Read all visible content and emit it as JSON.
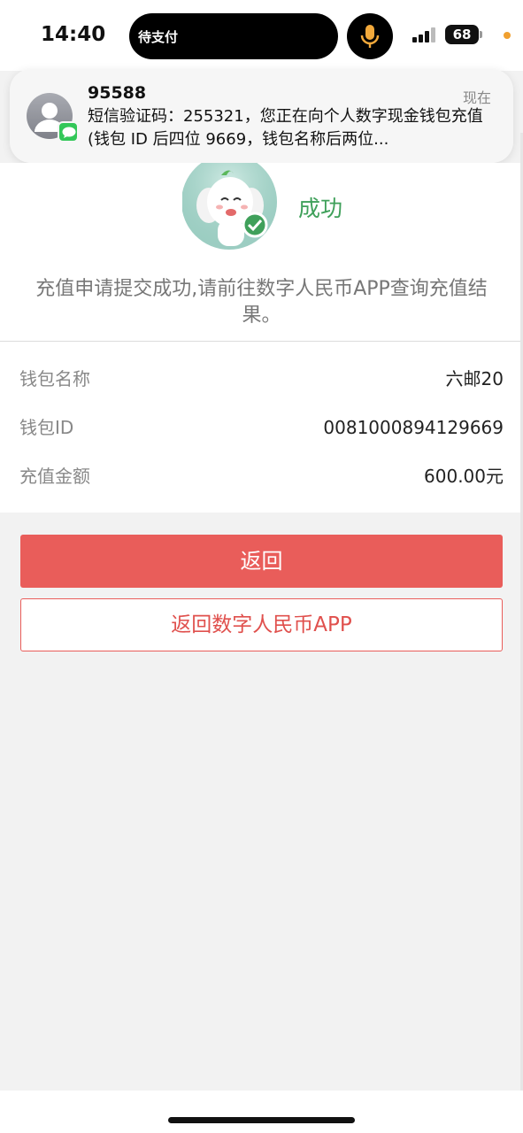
{
  "status_bar": {
    "time": "14:40",
    "island_label": "待支付",
    "battery": "68",
    "mic_color": "#f2a93b",
    "icons": [
      "mic-icon",
      "signal-icon",
      "battery-icon"
    ]
  },
  "notification": {
    "sender": "95588",
    "time": "现在",
    "body": "短信验证码：255321，您正在向个人数字现金钱包充值 (钱包 ID 后四位 9669，钱包名称后两位...",
    "icons": [
      "contact-avatar-icon",
      "messages-app-icon"
    ]
  },
  "result": {
    "status": "成功",
    "message": "充值申请提交成功,请前往数字人民币APP查询充值结果。",
    "status_color": "#3fa05a",
    "icon": "elephant-mascot-success-icon"
  },
  "details": [
    {
      "label": "钱包名称",
      "value": "六邮20"
    },
    {
      "label": "钱包ID",
      "value": "0081000894129669"
    },
    {
      "label": "充值金额",
      "value": "600.00元"
    }
  ],
  "buttons": {
    "back": "返回",
    "back_to_app": "返回数字人民币APP",
    "accent_color": "#e95d5a"
  }
}
